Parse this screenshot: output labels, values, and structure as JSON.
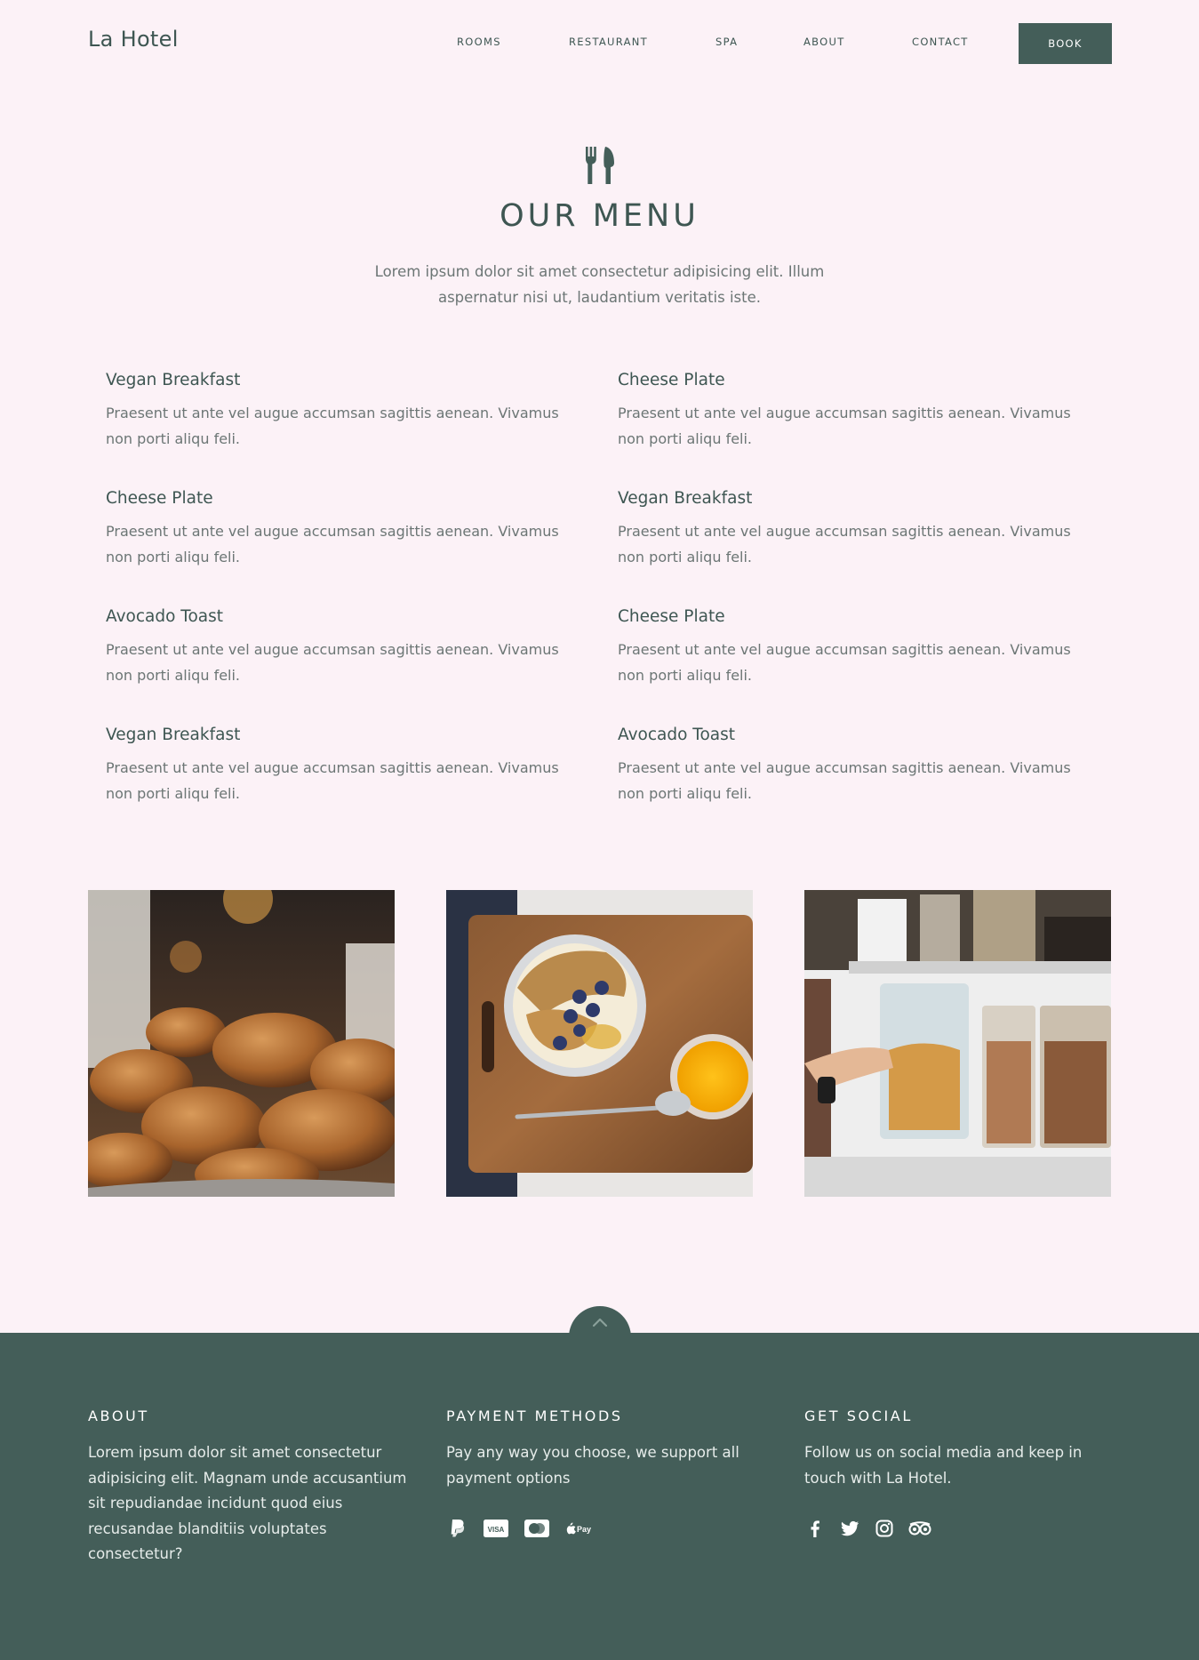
{
  "header": {
    "logo": "La Hotel",
    "nav": [
      "ROOMS",
      "RESTAURANT",
      "SPA",
      "ABOUT",
      "CONTACT"
    ],
    "book_label": "BOOK"
  },
  "menu": {
    "icon": "utensils-icon",
    "title": "OUR MENU",
    "intro": "Lorem ipsum dolor sit amet consectetur adipisicing elit. Illum aspernatur nisi ut, laudantium veritatis iste.",
    "items": [
      {
        "name": "Vegan Breakfast",
        "desc": "Praesent ut ante vel augue accumsan sagittis aenean. Vivamus non porti aliqu feli."
      },
      {
        "name": "Cheese Plate",
        "desc": "Praesent ut ante vel augue accumsan sagittis aenean. Vivamus non porti aliqu feli."
      },
      {
        "name": "Cheese Plate",
        "desc": "Praesent ut ante vel augue accumsan sagittis aenean. Vivamus non porti aliqu feli."
      },
      {
        "name": "Vegan Breakfast",
        "desc": "Praesent ut ante vel augue accumsan sagittis aenean. Vivamus non porti aliqu feli."
      },
      {
        "name": "Avocado Toast",
        "desc": "Praesent ut ante vel augue accumsan sagittis aenean. Vivamus non porti aliqu feli."
      },
      {
        "name": "Cheese Plate",
        "desc": "Praesent ut ante vel augue accumsan sagittis aenean. Vivamus non porti aliqu feli."
      },
      {
        "name": "Vegan Breakfast",
        "desc": "Praesent ut ante vel augue accumsan sagittis aenean. Vivamus non porti aliqu feli."
      },
      {
        "name": "Avocado Toast",
        "desc": "Praesent ut ante vel augue accumsan sagittis aenean. Vivamus non porti aliqu feli."
      }
    ]
  },
  "photos": [
    "croissants-photo",
    "breakfast-bowl-photo",
    "pantry-jars-photo"
  ],
  "footer": {
    "about": {
      "heading": "ABOUT",
      "text": "Lorem ipsum dolor sit amet consectetur adipisicing elit. Magnam unde accusantium sit repudiandae incidunt quod eius recusandae blanditiis voluptates consectetur?"
    },
    "payment": {
      "heading": "PAYMENT METHODS",
      "text": "Pay any way you choose, we support all payment options",
      "icons": [
        "paypal-icon",
        "visa-icon",
        "mastercard-icon",
        "apple-pay-icon"
      ],
      "visa_label": "VISA",
      "applepay_label": "Pay"
    },
    "social": {
      "heading": "GET SOCIAL",
      "text": "Follow us on social media and keep in touch with La Hotel.",
      "icons": [
        "facebook-icon",
        "twitter-icon",
        "instagram-icon",
        "tripadvisor-icon"
      ]
    }
  },
  "colors": {
    "background": "#fcf2f7",
    "accent": "#445e59",
    "text": "#3e5652",
    "muted": "#6c7675"
  }
}
